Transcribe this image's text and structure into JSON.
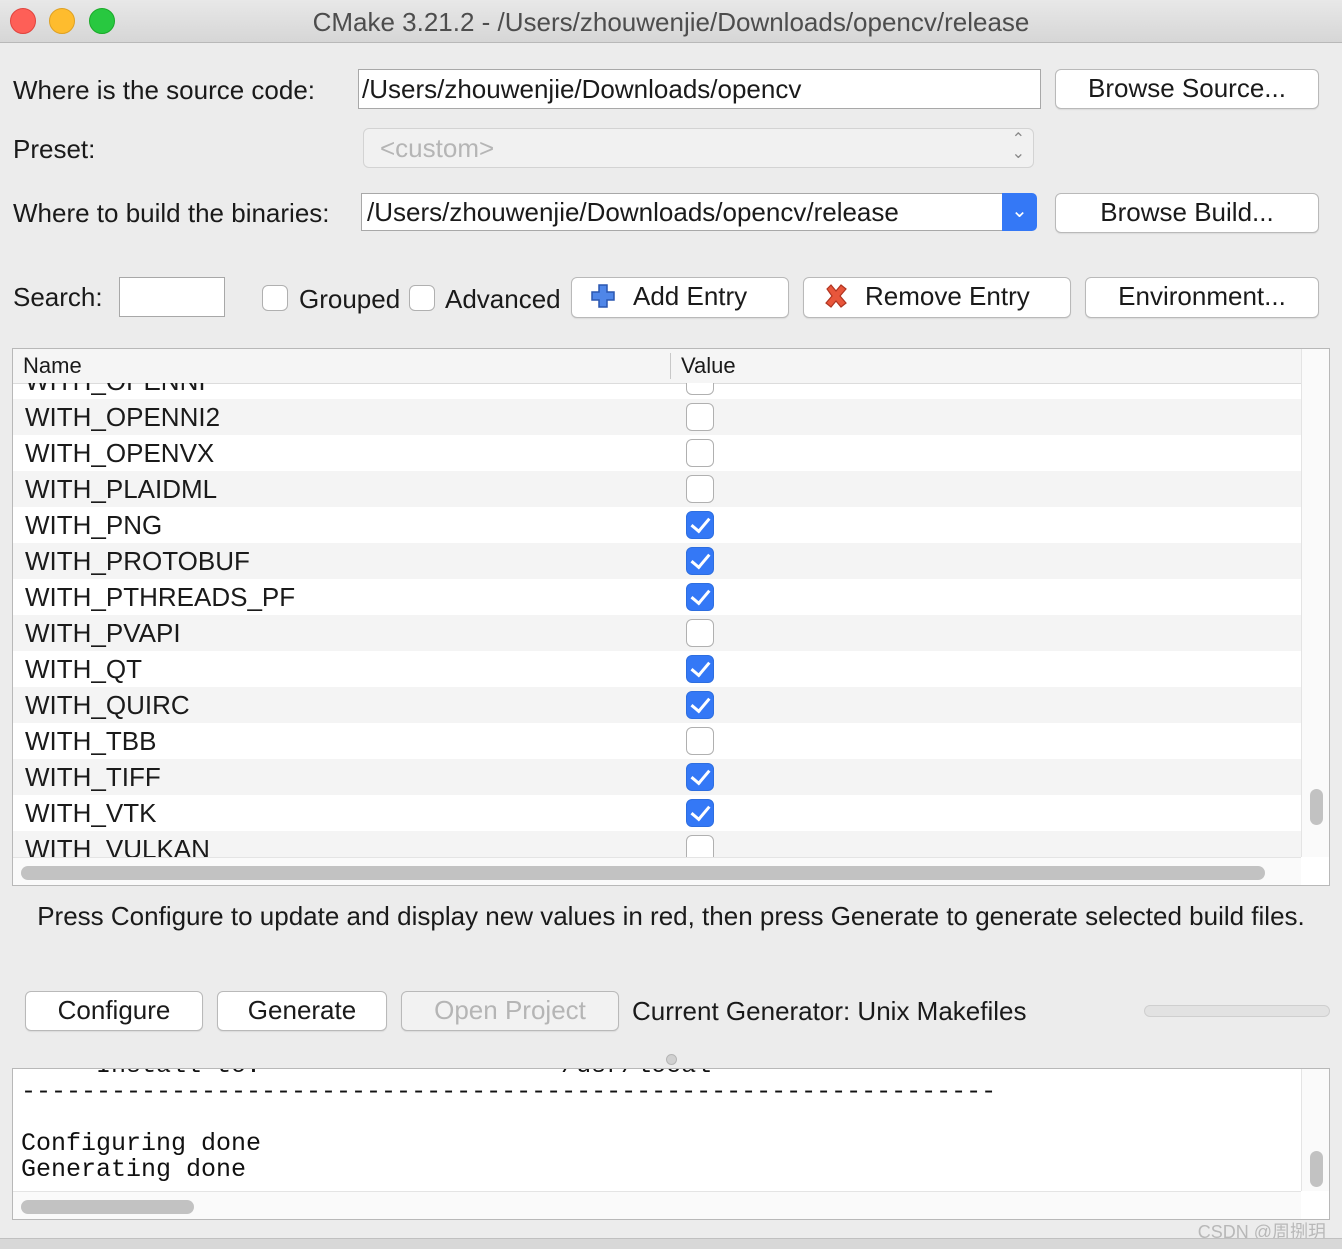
{
  "window": {
    "title": "CMake 3.21.2 - /Users/zhouwenjie/Downloads/opencv/release"
  },
  "source": {
    "label": "Where is the source code:",
    "value": "/Users/zhouwenjie/Downloads/opencv",
    "browse_label": "Browse Source..."
  },
  "preset": {
    "label": "Preset:",
    "value": "<custom>"
  },
  "build": {
    "label": "Where to build the binaries:",
    "value": "/Users/zhouwenjie/Downloads/opencv/release",
    "browse_label": "Browse Build..."
  },
  "toolbar": {
    "search_label": "Search:",
    "search_value": "",
    "grouped_label": "Grouped",
    "grouped_checked": false,
    "advanced_label": "Advanced",
    "advanced_checked": false,
    "add_entry_label": "Add Entry",
    "remove_entry_label": "Remove Entry",
    "environment_label": "Environment..."
  },
  "table": {
    "columns": [
      "Name",
      "Value"
    ],
    "rows": [
      {
        "name": "WITH_OPENNI",
        "checked": false
      },
      {
        "name": "WITH_OPENNI2",
        "checked": false
      },
      {
        "name": "WITH_OPENVX",
        "checked": false
      },
      {
        "name": "WITH_PLAIDML",
        "checked": false
      },
      {
        "name": "WITH_PNG",
        "checked": true
      },
      {
        "name": "WITH_PROTOBUF",
        "checked": true
      },
      {
        "name": "WITH_PTHREADS_PF",
        "checked": true
      },
      {
        "name": "WITH_PVAPI",
        "checked": false
      },
      {
        "name": "WITH_QT",
        "checked": true
      },
      {
        "name": "WITH_QUIRC",
        "checked": true
      },
      {
        "name": "WITH_TBB",
        "checked": false
      },
      {
        "name": "WITH_TIFF",
        "checked": true
      },
      {
        "name": "WITH_VTK",
        "checked": true
      },
      {
        "name": "WITH_VULKAN",
        "checked": false
      }
    ]
  },
  "message": "Press Configure to update and display new values in red, then press Generate to generate selected build files.",
  "actions": {
    "configure_label": "Configure",
    "generate_label": "Generate",
    "open_project_label": "Open Project",
    "generator_text": "Current Generator: Unix Makefiles"
  },
  "output": {
    "lines": [
      "--   Install to:                    /usr/local",
      "-----------------------------------------------------------------",
      "",
      "Configuring done",
      "Generating done"
    ]
  },
  "watermark": "CSDN @周捌玥"
}
